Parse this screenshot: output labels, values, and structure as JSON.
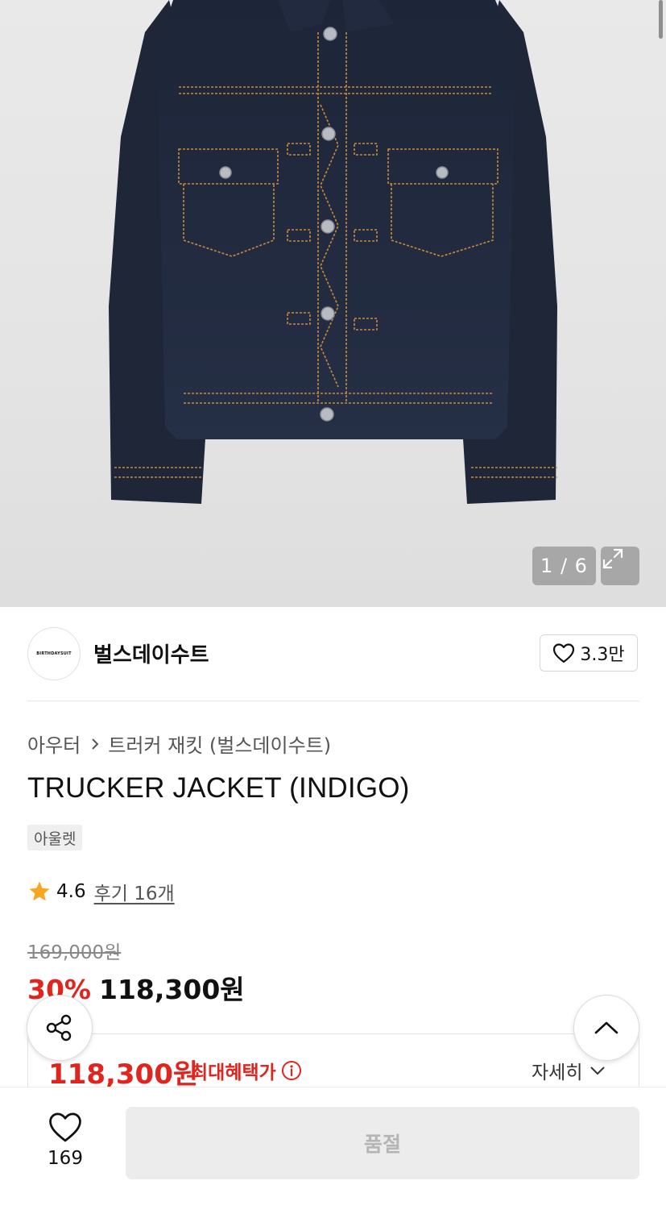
{
  "gallery": {
    "counter": "1 / 6",
    "expand_icon": "expand-icon"
  },
  "brand": {
    "logo_text": "BIRTHDAYSUIT",
    "name": "벌스데이수트",
    "like_count": "3.3만"
  },
  "product": {
    "breadcrumb": {
      "category": "아우터",
      "subcategory": "트러커 재킷 (벌스데이수트)"
    },
    "title": "TRUCKER JACKET (INDIGO)",
    "tag": "아울렛",
    "rating": {
      "score": "4.6",
      "reviews_label": "후기 16개"
    },
    "original_price": "169,000원",
    "discount_rate": "30%",
    "sale_price": "118,300원"
  },
  "benefit": {
    "price": "118,300원",
    "label": "최대혜택가",
    "detail_label": "자세히"
  },
  "bottom_bar": {
    "wish_count": "169",
    "cta_label": "품절"
  },
  "colors": {
    "accent_red": "#e1241e",
    "denim": "#1f2a40",
    "stitch": "#c98a3a"
  }
}
